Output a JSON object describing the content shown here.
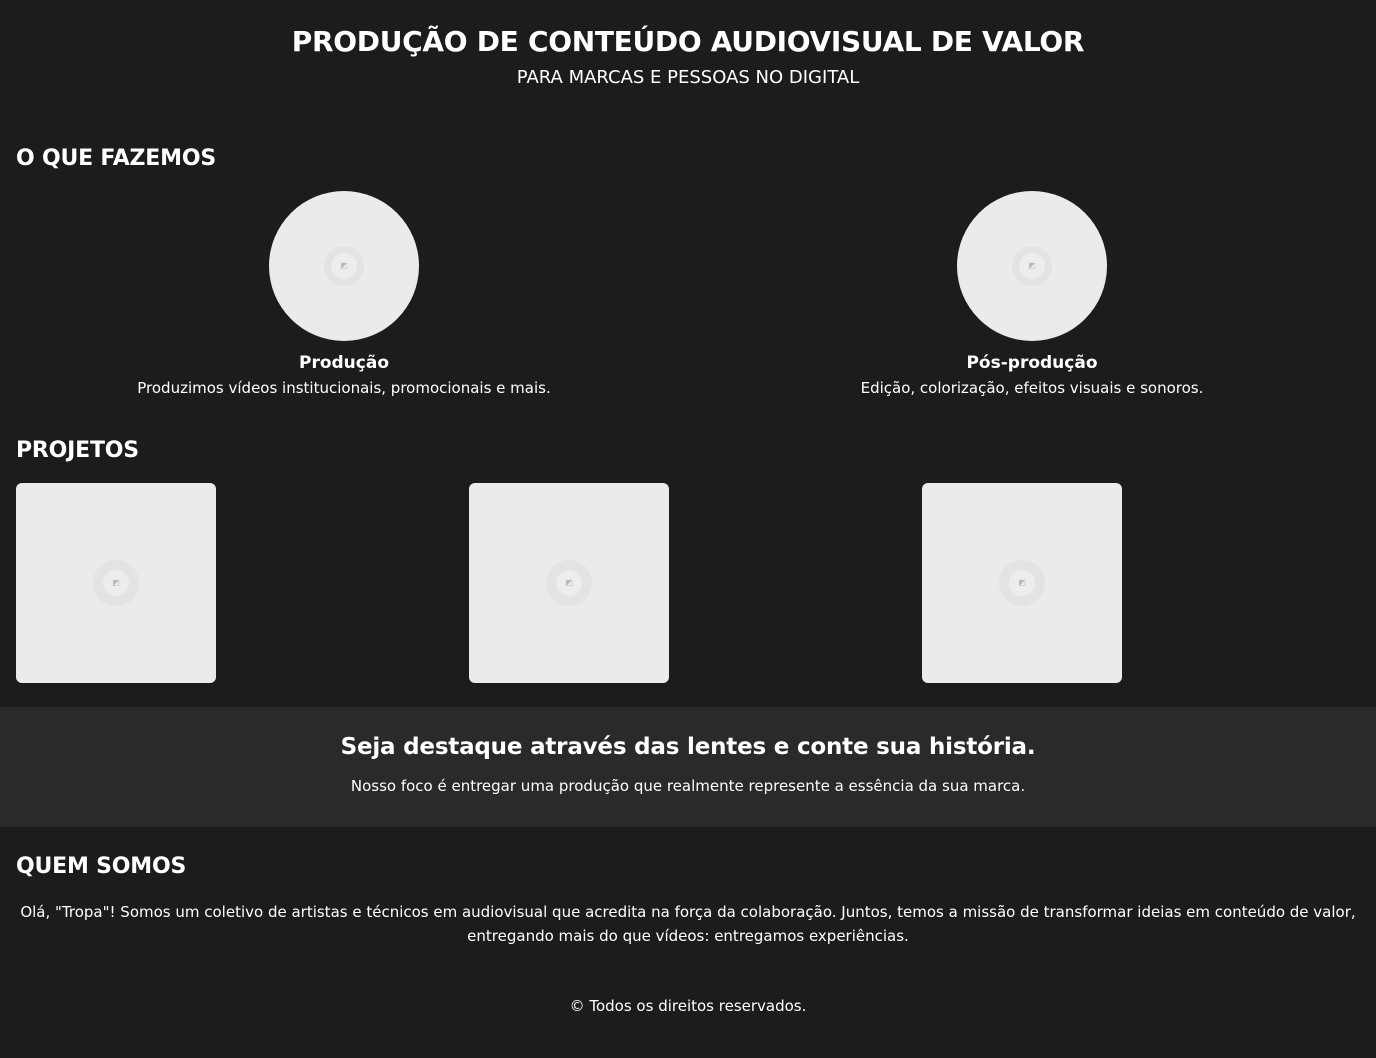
{
  "hero": {
    "title": "PRODUÇÃO DE CONTEÚDO AUDIOVISUAL DE VALOR",
    "subtitle": "PARA MARCAS E PESSOAS NO DIGITAL"
  },
  "services": {
    "heading": "O QUE FAZEMOS",
    "items": [
      {
        "name": "Produção",
        "description": "Produzimos vídeos institucionais, promocionais e mais.",
        "icon": "image-placeholder-icon"
      },
      {
        "name": "Pós-produção",
        "description": "Edição, colorização, efeitos visuais e sonoros.",
        "icon": "image-placeholder-icon"
      }
    ]
  },
  "projects": {
    "heading": "PROJETOS",
    "items": [
      {
        "icon": "image-placeholder-icon"
      },
      {
        "icon": "image-placeholder-icon"
      },
      {
        "icon": "image-placeholder-icon"
      }
    ]
  },
  "banner": {
    "headline": "Seja destaque através das lentes e conte sua história.",
    "text": "Nosso foco é entregar uma produção que realmente represente a essência da sua marca."
  },
  "about": {
    "heading": "QUEM SOMOS",
    "text": "Olá, \"Tropa\"! Somos um coletivo de artistas e técnicos em audiovisual que acredita na força da colaboração. Juntos, temos a missão de transformar ideias em conteúdo de valor, entregando mais do que vídeos: entregamos experiências."
  },
  "footer": {
    "copyright": "© Todos os direitos reservados."
  },
  "colors": {
    "background": "#1c1c1c",
    "banner_background": "#2a2a2a",
    "placeholder": "#ebebeb",
    "text": "#ffffff"
  }
}
